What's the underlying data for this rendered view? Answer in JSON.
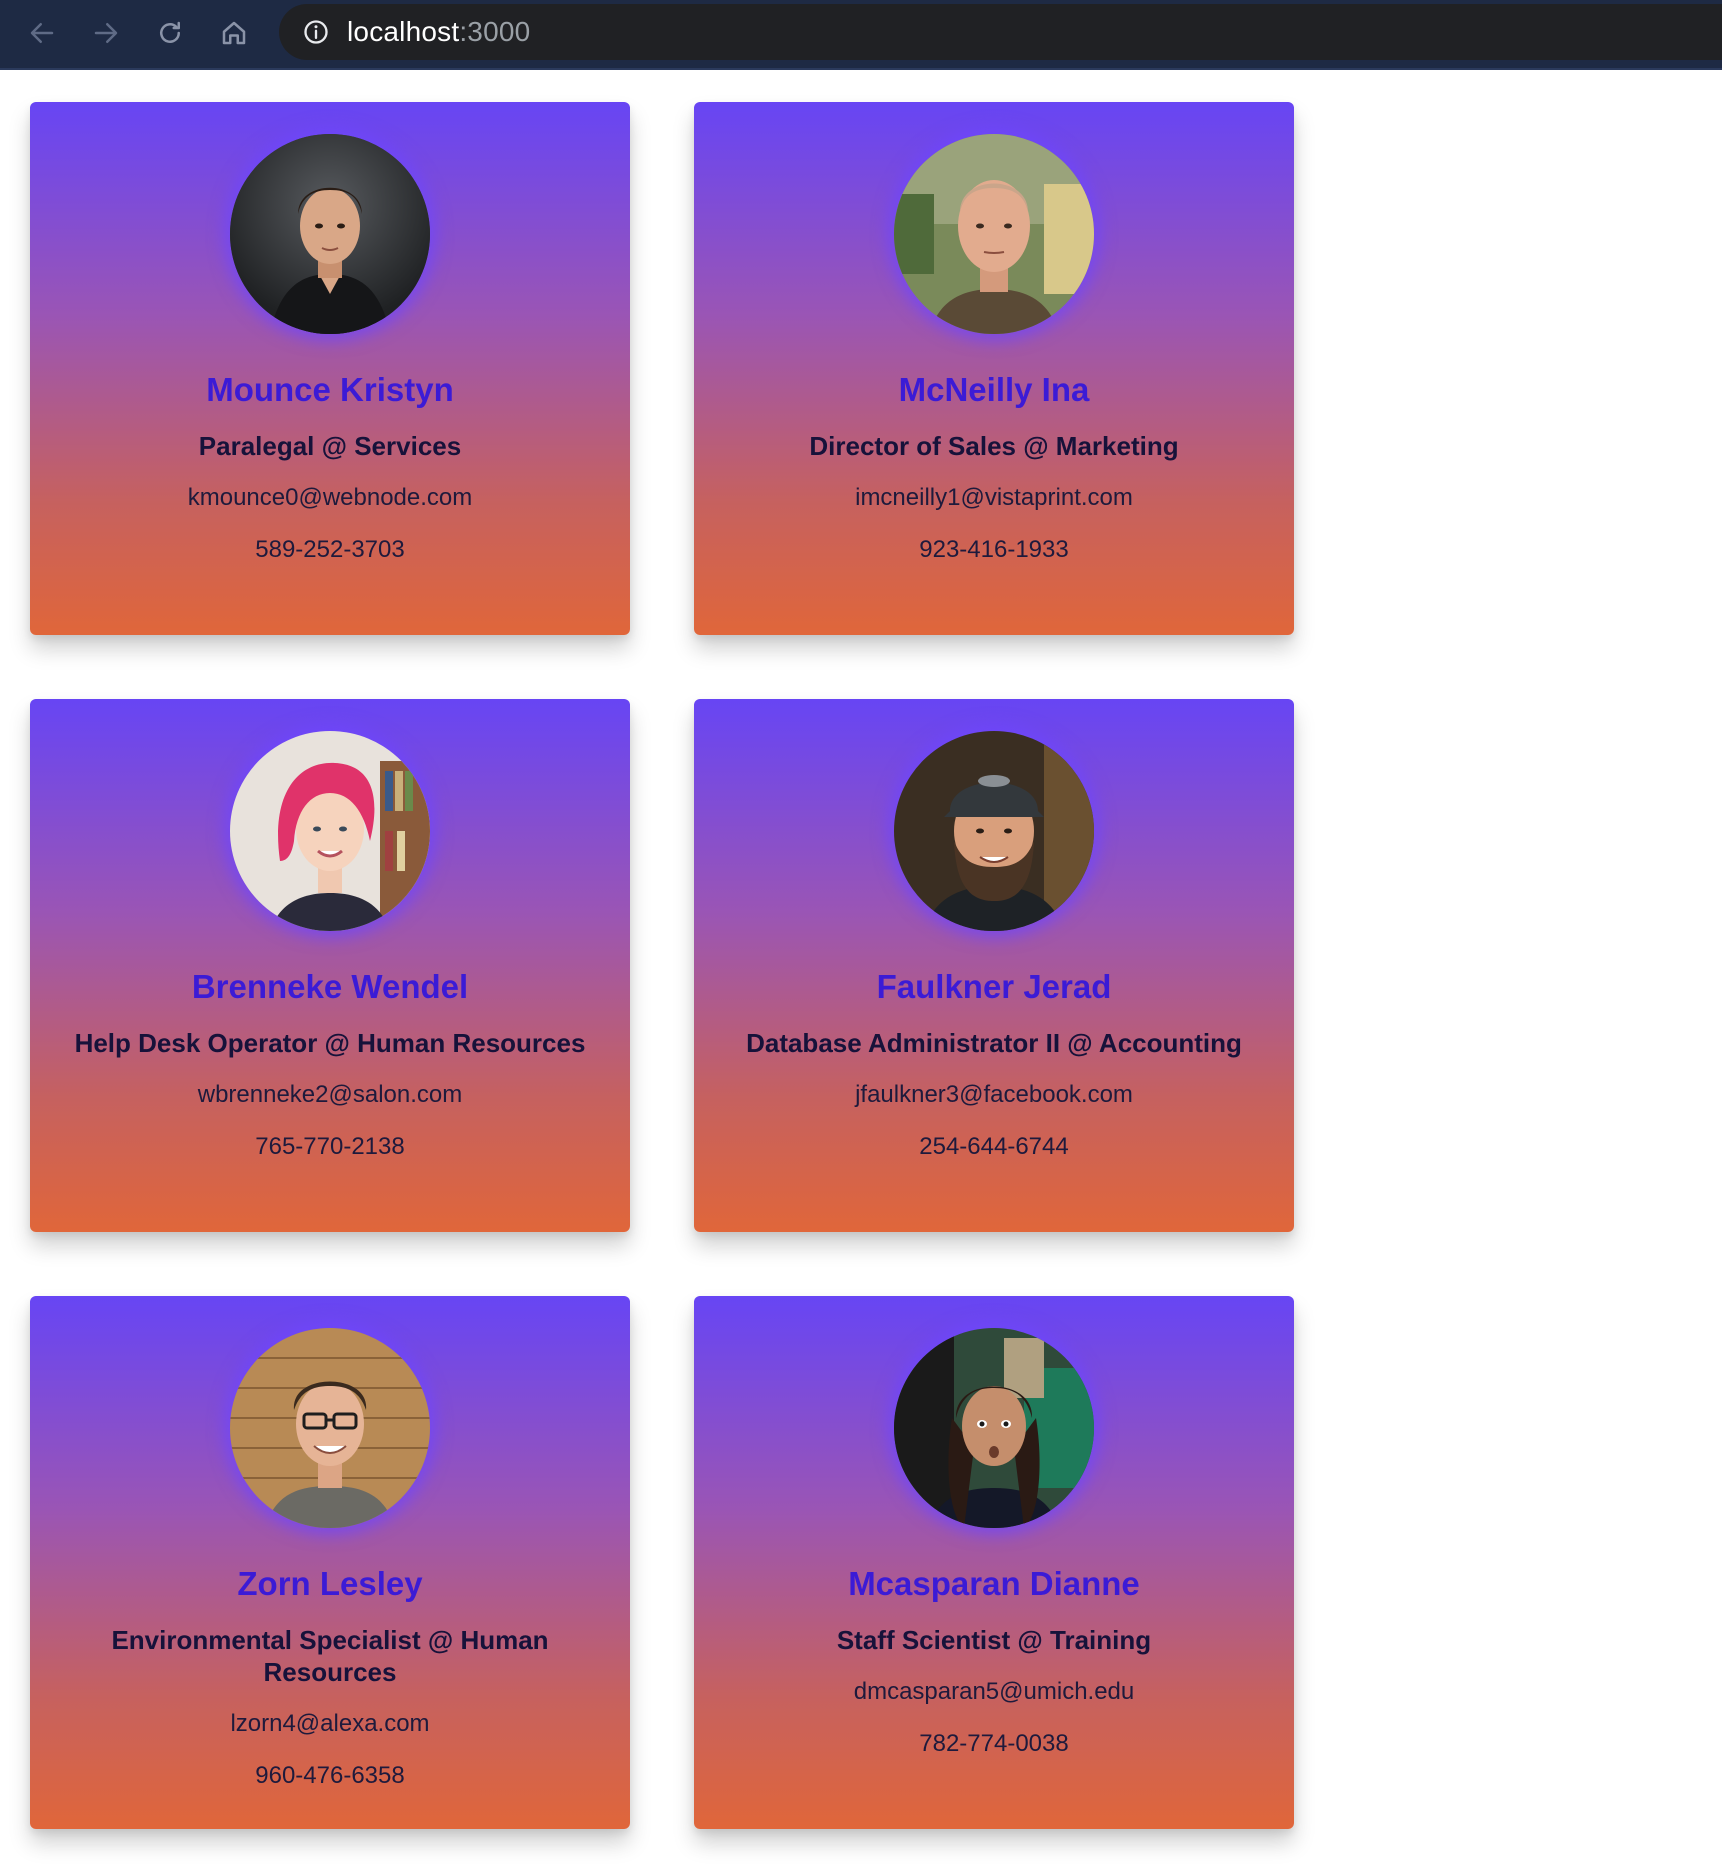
{
  "browser": {
    "url_host": "localhost",
    "url_port": ":3000",
    "icons": {
      "back": "arrow-left-icon",
      "forward": "arrow-right-icon",
      "reload": "reload-icon",
      "home": "home-icon",
      "site_info": "info-icon"
    }
  },
  "colors": {
    "card_gradient_top": "#6745f4",
    "card_gradient_bottom": "#e0663a",
    "name_color": "#3b1bd6",
    "avatar_glow": "#6e46ff"
  },
  "employees": [
    {
      "name": "Mounce Kristyn",
      "role": "Paralegal @ Services",
      "email": "kmounce0@webnode.com",
      "phone": "589-252-3703"
    },
    {
      "name": "McNeilly Ina",
      "role": "Director of Sales @ Marketing",
      "email": "imcneilly1@vistaprint.com",
      "phone": "923-416-1933"
    },
    {
      "name": "Brenneke Wendel",
      "role": "Help Desk Operator @ Human Resources",
      "email": "wbrenneke2@salon.com",
      "phone": "765-770-2138"
    },
    {
      "name": "Faulkner Jerad",
      "role": "Database Administrator II @ Accounting",
      "email": "jfaulkner3@facebook.com",
      "phone": "254-644-6744"
    },
    {
      "name": "Zorn Lesley",
      "role": "Environmental Specialist @ Human Resources",
      "email": "lzorn4@alexa.com",
      "phone": "960-476-6358"
    },
    {
      "name": "Mcasparan Dianne",
      "role": "Staff Scientist @ Training",
      "email": "dmcasparan5@umich.edu",
      "phone": "782-774-0038"
    }
  ]
}
